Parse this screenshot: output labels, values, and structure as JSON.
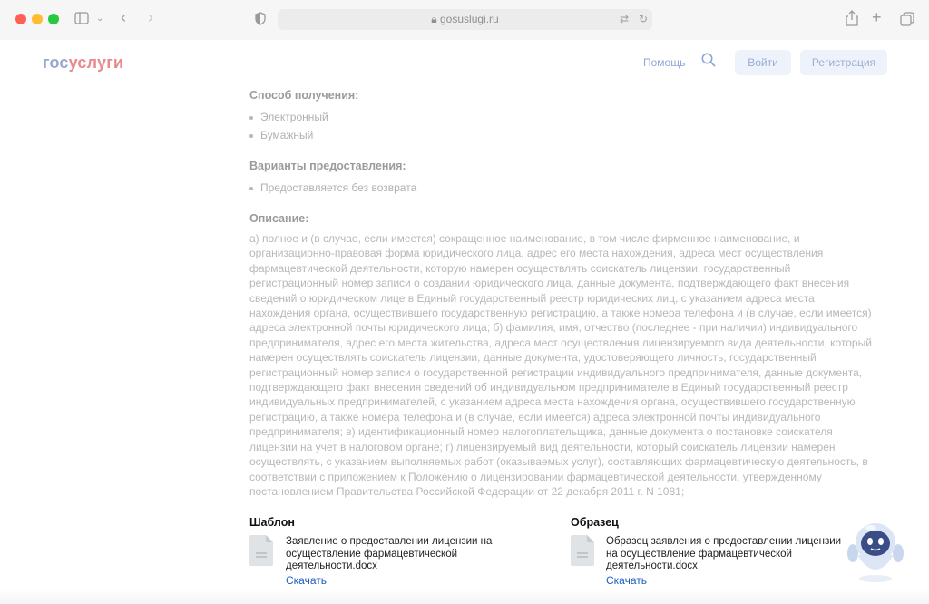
{
  "browser": {
    "url": "gosuslugi.ru"
  },
  "header": {
    "logo_part1": "гос",
    "logo_part2": "услуги",
    "help": "Помощь",
    "login": "Войти",
    "register": "Регистрация"
  },
  "receipt": {
    "title": "Способ получения:",
    "items": [
      "Электронный",
      "Бумажный"
    ]
  },
  "provision": {
    "title": "Варианты предоставления:",
    "items": [
      "Предоставляется без возврата"
    ]
  },
  "description": {
    "title": "Описание:",
    "lines": [
      "а) полное и (в случае, если имеется) сокращенное наименование, в том числе фирменное наименование, и",
      "организационно-правовая форма юридического лица, адрес его места нахождения, адреса мест осуществления",
      "фармацевтической деятельности, которую намерен осуществлять соискатель лицензии, государственный",
      "регистрационный номер записи о создании юридического лица, данные документа, подтверждающего факт внесения",
      "сведений о юридическом лице в Единый государственный реестр юридических лиц, с указанием адреса места",
      "нахождения органа, осуществившего государственную регистрацию, а также номера телефона и (в случае, если имеется)",
      "адреса электронной почты юридического лица; б) фамилия, имя, отчество (последнее - при наличии) индивидуального",
      "предпринимателя, адрес его места жительства, адреса мест осуществления лицензируемого вида деятельности, который",
      "намерен осуществлять соискатель лицензии, данные документа, удостоверяющего личность, государственный",
      "регистрационный номер записи о государственной регистрации индивидуального предпринимателя, данные документа,",
      "подтверждающего факт внесения сведений об индивидуальном предпринимателе в Единый государственный реестр",
      "индивидуальных предпринимателей, с указанием адреса места нахождения органа, осуществившего государственную",
      "регистрацию, а также номера телефона и (в случае, если имеется) адреса электронной почты индивидуального",
      "предпринимателя; в) идентификационный номер налогоплательщика, данные документа о постановке соискателя",
      "лицензии на учет в налоговом органе; г) лицензируемый вид деятельности, который соискатель лицензии намерен",
      "осуществлять, с указанием выполняемых работ (оказываемых услуг), составляющих фармацевтическую деятельность, в",
      "соответствии с приложением к Положению о лицензировании фармацевтической деятельности, утвержденному",
      "постановлением Правительства Российской Федерации от 22 декабря 2011 г. N 1081;"
    ]
  },
  "template": {
    "title": "Шаблон",
    "file_lines": [
      "Заявление о предоставлении лицензии на",
      "осуществление фармацевтической",
      "деятельности.docx"
    ],
    "download": "Скачать"
  },
  "sample": {
    "title": "Образец",
    "file_lines": [
      "Образец заявления о предоставлении лицензии",
      "на осуществление фармацевтической",
      "деятельности.docx"
    ],
    "download": "Скачать"
  }
}
